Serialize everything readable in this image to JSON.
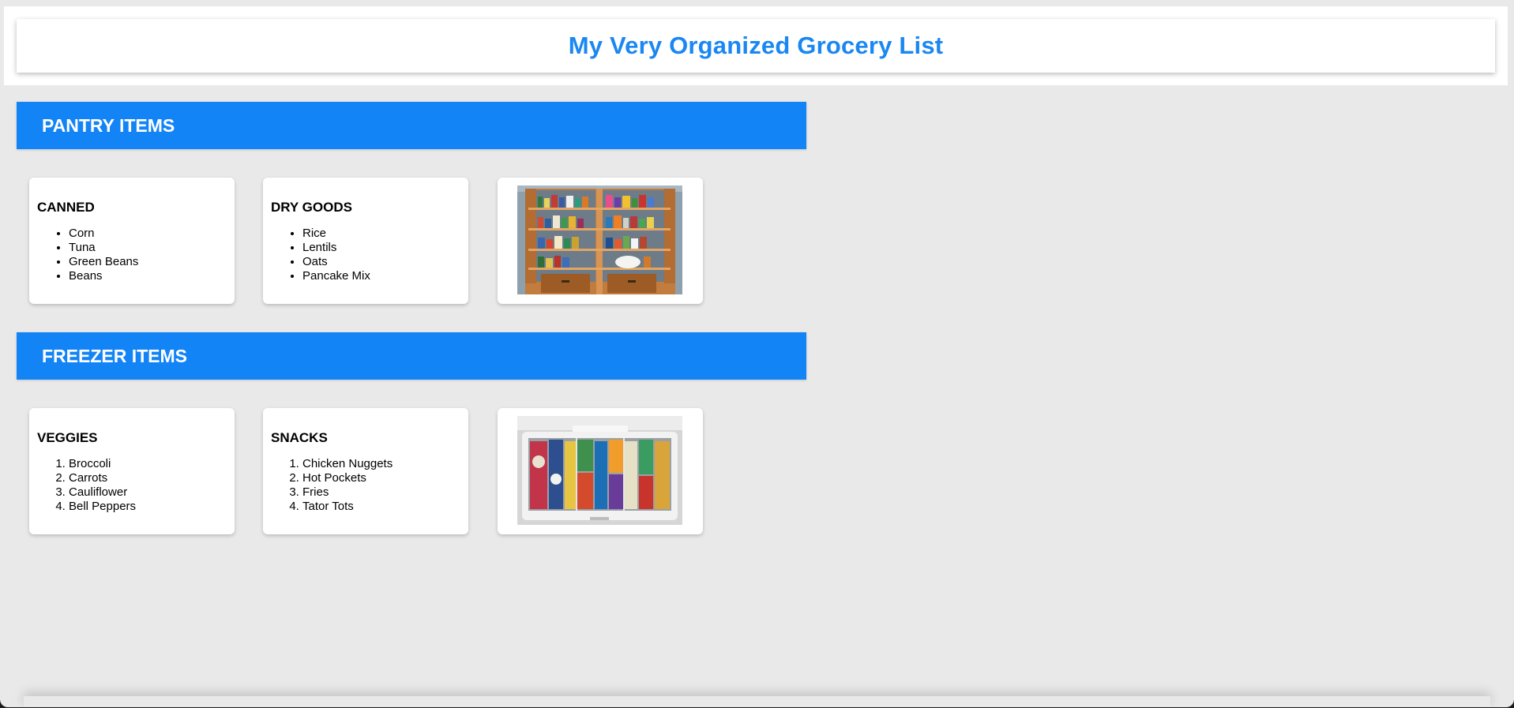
{
  "header": {
    "title": "My Very Organized Grocery List"
  },
  "pantry": {
    "heading": "PANTRY ITEMS",
    "canned": {
      "title": "CANNED",
      "items": [
        "Corn",
        "Tuna",
        "Green Beans",
        "Beans"
      ]
    },
    "dry_goods": {
      "title": "DRY GOODS",
      "items": [
        "Rice",
        "Lentils",
        "Oats",
        "Pancake Mix"
      ]
    }
  },
  "freezer": {
    "heading": "FREEZER ITEMS",
    "veggies": {
      "title": "VEGGIES",
      "items": [
        "Broccoli",
        "Carrots",
        "Cauliflower",
        "Bell Peppers"
      ]
    },
    "snacks": {
      "title": "SNACKS",
      "items": [
        "Chicken Nuggets",
        "Hot Pockets",
        "Fries",
        "Tator Tots"
      ]
    }
  },
  "colors": {
    "accent": "#1384f6",
    "title": "#1a87f2",
    "background": "#e9e9e9"
  }
}
